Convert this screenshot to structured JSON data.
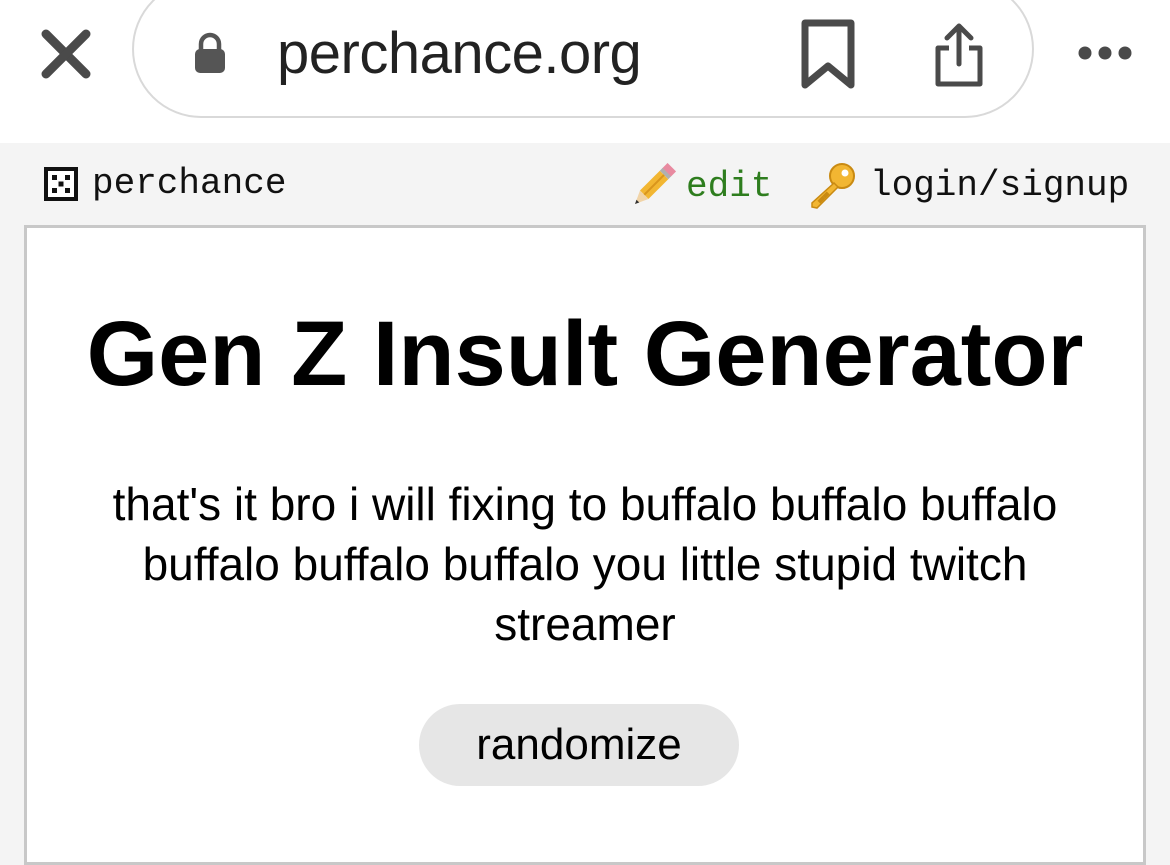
{
  "browser": {
    "url": "perchance.org",
    "icons": {
      "close": "close-icon",
      "lock": "lock-icon",
      "bookmark": "bookmark-icon",
      "share": "share-icon",
      "more": "more-icon"
    }
  },
  "site_header": {
    "brand_label": "perchance",
    "brand_icon": "dice-icon",
    "edit_label": "edit",
    "edit_icon": "pencil-icon",
    "login_label": "login/signup",
    "login_icon": "key-icon"
  },
  "main": {
    "title": "Gen Z Insult Generator",
    "result": "that's it bro i will fixing to buffalo buffalo buffalo buffalo buffalo buffalo you little stupid twitch streamer",
    "randomize_label": "randomize"
  },
  "colors": {
    "edit_link": "#2e7d1e",
    "button_bg": "#e6e6e6",
    "panel_border": "#c8c8c8",
    "page_bg": "#f4f4f4"
  }
}
